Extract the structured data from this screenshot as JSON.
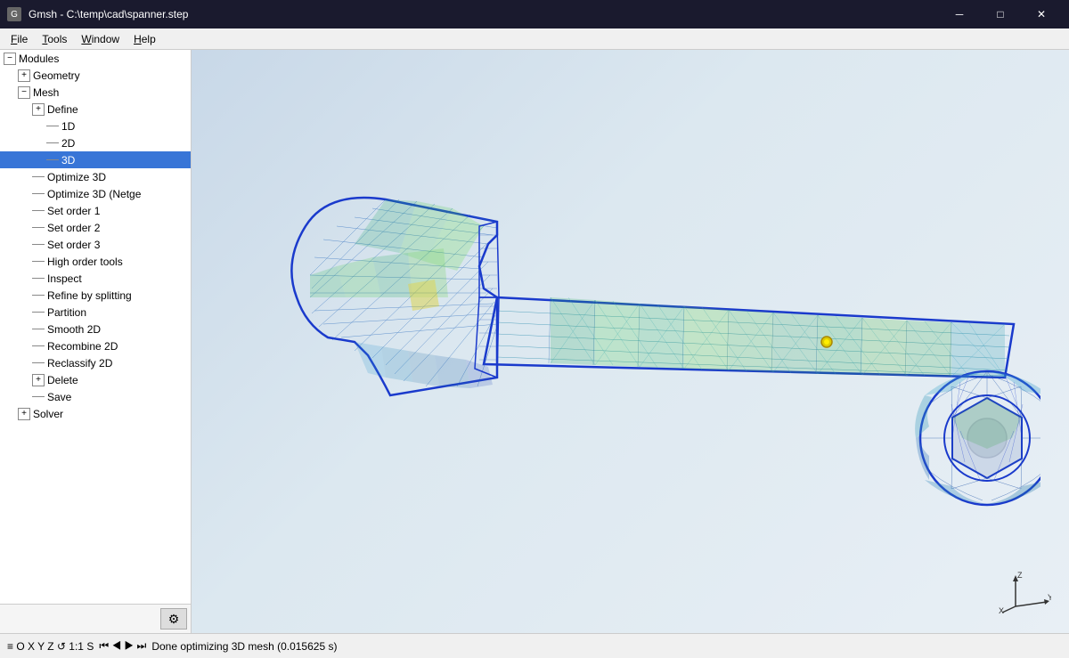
{
  "titleBar": {
    "icon": "G",
    "title": "Gmsh - C:\\temp\\cad\\spanner.step",
    "minimize": "─",
    "maximize": "□",
    "close": "✕"
  },
  "menuBar": {
    "items": [
      {
        "label": "File",
        "underline": "F"
      },
      {
        "label": "Tools",
        "underline": "T"
      },
      {
        "label": "Window",
        "underline": "W"
      },
      {
        "label": "Help",
        "underline": "H"
      }
    ]
  },
  "sidebar": {
    "modules_label": "Modules",
    "tree": [
      {
        "id": "modules",
        "label": "Modules",
        "level": 0,
        "type": "root-expand",
        "expanded": true
      },
      {
        "id": "geometry",
        "label": "Geometry",
        "level": 1,
        "type": "expand"
      },
      {
        "id": "mesh",
        "label": "Mesh",
        "level": 1,
        "type": "expand",
        "expanded": true
      },
      {
        "id": "define",
        "label": "Define",
        "level": 2,
        "type": "expand"
      },
      {
        "id": "1d",
        "label": "1D",
        "level": 3,
        "type": "leaf"
      },
      {
        "id": "2d",
        "label": "2D",
        "level": 3,
        "type": "leaf"
      },
      {
        "id": "3d",
        "label": "3D",
        "level": 3,
        "type": "leaf",
        "selected": true
      },
      {
        "id": "optimize3d",
        "label": "Optimize 3D",
        "level": 2,
        "type": "leaf"
      },
      {
        "id": "optimize3d-netgen",
        "label": "Optimize 3D (Netge",
        "level": 2,
        "type": "leaf"
      },
      {
        "id": "setorder1",
        "label": "Set order 1",
        "level": 2,
        "type": "leaf"
      },
      {
        "id": "setorder2",
        "label": "Set order 2",
        "level": 2,
        "type": "leaf"
      },
      {
        "id": "setorder3",
        "label": "Set order 3",
        "level": 2,
        "type": "leaf"
      },
      {
        "id": "highordertools",
        "label": "High order tools",
        "level": 2,
        "type": "leaf"
      },
      {
        "id": "inspect",
        "label": "Inspect",
        "level": 2,
        "type": "leaf"
      },
      {
        "id": "refinebysplitting",
        "label": "Refine by splitting",
        "level": 2,
        "type": "leaf"
      },
      {
        "id": "partition",
        "label": "Partition",
        "level": 2,
        "type": "leaf"
      },
      {
        "id": "smooth2d",
        "label": "Smooth 2D",
        "level": 2,
        "type": "leaf"
      },
      {
        "id": "recombine2d",
        "label": "Recombine 2D",
        "level": 2,
        "type": "leaf"
      },
      {
        "id": "reclassify2d",
        "label": "Reclassify 2D",
        "level": 2,
        "type": "leaf"
      },
      {
        "id": "delete",
        "label": "Delete",
        "level": 2,
        "type": "expand"
      },
      {
        "id": "save",
        "label": "Save",
        "level": 2,
        "type": "leaf"
      },
      {
        "id": "solver",
        "label": "Solver",
        "level": 1,
        "type": "expand"
      }
    ],
    "settingsBtn": "⚙"
  },
  "statusBar": {
    "icons": "≡ O X Y Z ↺ 1:1 S",
    "navIcons": "⏮ ◀ ▶ ⏭",
    "message": "Done optimizing 3D mesh (0.015625 s)"
  },
  "axes": {
    "x": "X",
    "y": "Y",
    "z": "Z"
  }
}
